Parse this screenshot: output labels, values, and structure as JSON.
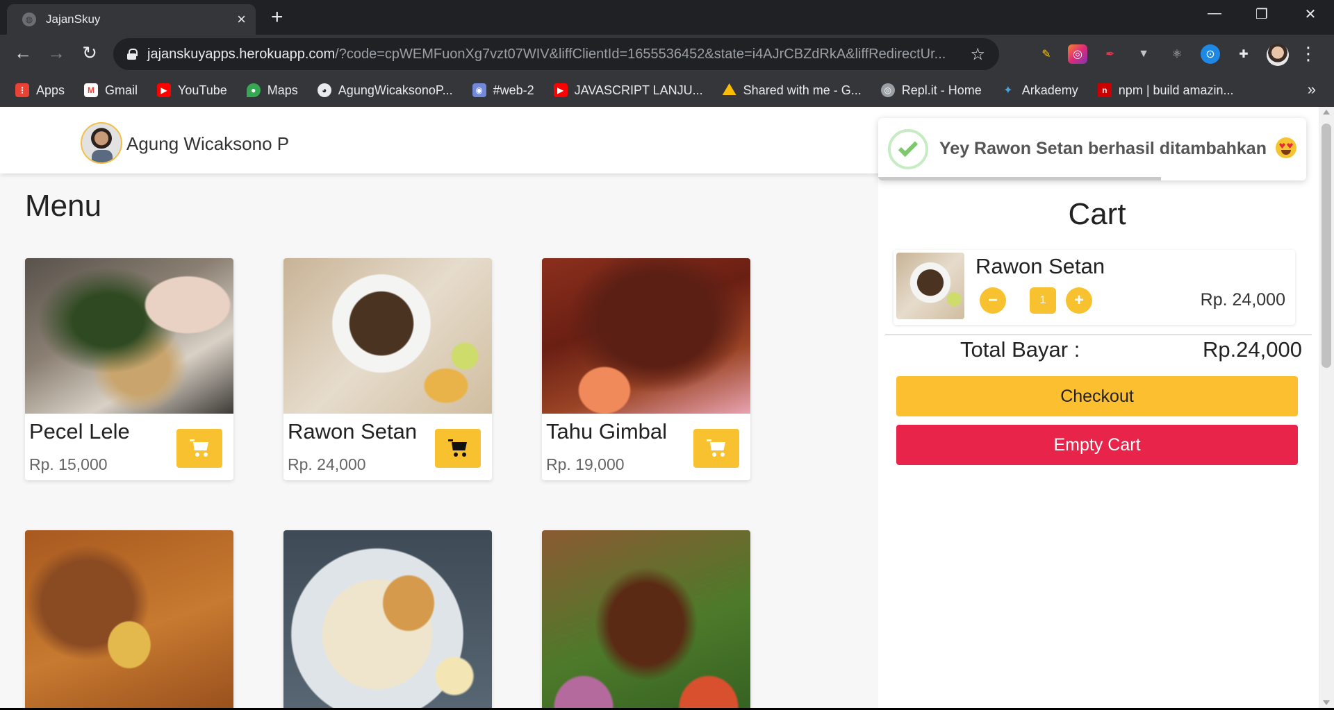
{
  "browser": {
    "tab_title": "JajanSkuy",
    "url_host": "jajanskuyapps.herokuapp.com",
    "url_rest": "/?code=cpWEMFuonXg7vzt07WIV&liffClientId=1655536452&state=i4AJrCBZdRkA&liffRedirectUr...",
    "bookmarks": [
      {
        "label": "Apps",
        "icon": "apps-grid-icon",
        "color": "#4285f4"
      },
      {
        "label": "Gmail",
        "icon": "gmail-icon",
        "color": "#ea4335"
      },
      {
        "label": "YouTube",
        "icon": "youtube-icon",
        "color": "#ff0000"
      },
      {
        "label": "Maps",
        "icon": "maps-icon",
        "color": "#34a853"
      },
      {
        "label": "AgungWicaksonoP...",
        "icon": "github-icon",
        "color": "#ffffff"
      },
      {
        "label": "#web-2",
        "icon": "discord-icon",
        "color": "#7289da"
      },
      {
        "label": "JAVASCRIPT LANJU...",
        "icon": "youtube-icon",
        "color": "#ff0000"
      },
      {
        "label": "Shared with me - G...",
        "icon": "drive-icon",
        "color": "#fbbc04"
      },
      {
        "label": "Repl.it - Home",
        "icon": "replit-icon",
        "color": "#9aa0a6"
      },
      {
        "label": "Arkademy",
        "icon": "arkademy-icon",
        "color": "#4aa3df"
      },
      {
        "label": "npm | build amazin...",
        "icon": "npm-icon",
        "color": "#cb0000"
      }
    ]
  },
  "user": {
    "name": "Agung Wicaksono P"
  },
  "menu": {
    "title": "Menu",
    "items": [
      {
        "name": "Pecel Lele",
        "price": "Rp. 15,000"
      },
      {
        "name": "Rawon Setan",
        "price": "Rp. 24,000"
      },
      {
        "name": "Tahu Gimbal",
        "price": "Rp. 19,000"
      }
    ]
  },
  "cart": {
    "title": "Cart",
    "items": [
      {
        "name": "Rawon Setan",
        "qty": "1",
        "price": "Rp. 24,000"
      }
    ],
    "total_label": "Total Bayar :",
    "total_value": "Rp.24,000",
    "checkout_label": "Checkout",
    "empty_label": "Empty Cart"
  },
  "toast": {
    "message": "Yey Rawon Setan berhasil ditambahkan",
    "progress_fraction": 0.66
  },
  "colors": {
    "accent_yellow": "#f8c12f",
    "danger_red": "#e9244a",
    "success_green": "#7cc96b"
  }
}
